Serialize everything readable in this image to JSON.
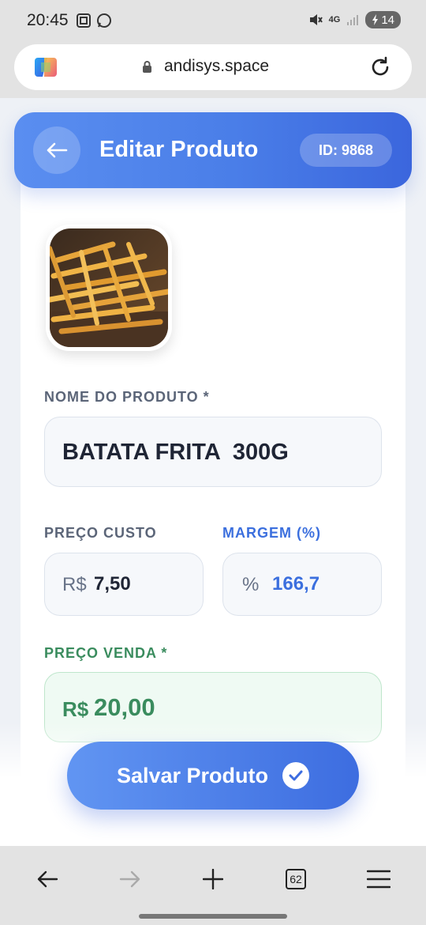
{
  "status_bar": {
    "time": "20:45",
    "network": "4G",
    "battery": "14"
  },
  "browser": {
    "url": "andisys.space",
    "tab_count": "62"
  },
  "header": {
    "title": "Editar Produto",
    "id_badge": "ID: 9868"
  },
  "product": {
    "image_icon": "french-fries-image"
  },
  "form": {
    "nome_label": "NOME DO PRODUTO *",
    "nome_value": "BATATA FRITA  300G",
    "custo_label": "PREÇO CUSTO",
    "custo_prefix": "R$",
    "custo_value": "7,50",
    "margem_label": "MARGEM (%)",
    "margem_prefix": "%",
    "margem_value": "166,7",
    "venda_label": "PREÇO VENDA *",
    "venda_prefix": "R$",
    "venda_value": "20,00"
  },
  "actions": {
    "save_label": "Salvar Produto"
  },
  "colors": {
    "accent": "#4a7ee8",
    "margin_blue": "#3b6fde",
    "sale_green": "#3a8c5e"
  }
}
